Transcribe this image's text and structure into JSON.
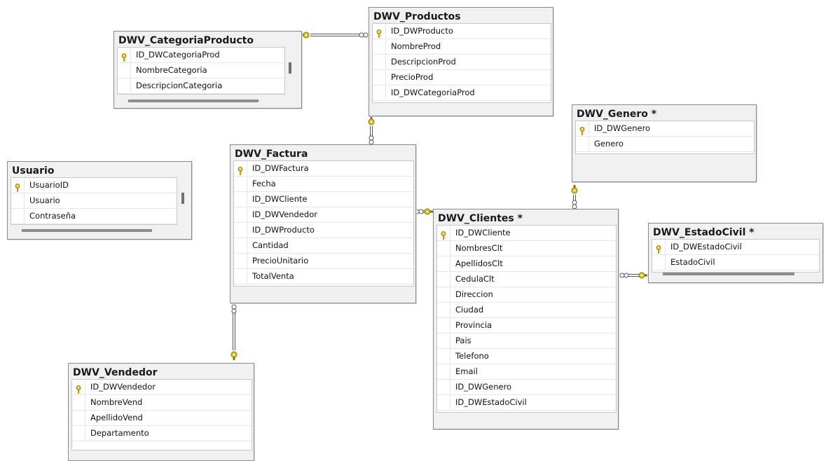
{
  "tables": {
    "categoria": {
      "title": "DWV_CategoriaProducto",
      "columns": [
        "ID_DWCategoriaProd",
        "NombreCategoria",
        "DescripcionCategoria"
      ],
      "pk": 0
    },
    "productos": {
      "title": "DWV_Productos",
      "columns": [
        "ID_DWProducto",
        "NombreProd",
        "DescripcionProd",
        "PrecioProd",
        "ID_DWCategoriaProd"
      ],
      "pk": 0
    },
    "genero": {
      "title": "DWV_Genero *",
      "columns": [
        "ID_DWGenero",
        "Genero"
      ],
      "pk": 0
    },
    "usuario": {
      "title": "Usuario",
      "columns": [
        "UsuarioID",
        "Usuario",
        "Contraseña"
      ],
      "pk": 0
    },
    "factura": {
      "title": "DWV_Factura",
      "columns": [
        "ID_DWFactura",
        "Fecha",
        "ID_DWCliente",
        "ID_DWVendedor",
        "ID_DWProducto",
        "Cantidad",
        "PrecioUnitario",
        "TotalVenta"
      ],
      "pk": 0
    },
    "clientes": {
      "title": "DWV_Clientes *",
      "columns": [
        "ID_DWCliente",
        "NombresClt",
        "ApellidosClt",
        "CedulaClt",
        "Direccion",
        "Ciudad",
        "Provincia",
        "Pais",
        "Telefono",
        "Email",
        "ID_DWGenero",
        "ID_DWEstadoCivil"
      ],
      "pk": 0
    },
    "estadocivil": {
      "title": "DWV_EstadoCivil *",
      "columns": [
        "ID_DWEstadoCivil",
        "EstadoCivil"
      ],
      "pk": 0
    },
    "vendedor": {
      "title": "DWV_Vendedor",
      "columns": [
        "ID_DWVendedor",
        "NombreVend",
        "ApellidoVend",
        "Departamento"
      ],
      "pk": 0
    }
  },
  "relationships": [
    {
      "from": "productos",
      "to": "categoria"
    },
    {
      "from": "factura",
      "to": "productos"
    },
    {
      "from": "factura",
      "to": "clientes"
    },
    {
      "from": "factura",
      "to": "vendedor"
    },
    {
      "from": "clientes",
      "to": "genero"
    },
    {
      "from": "clientes",
      "to": "estadocivil"
    }
  ],
  "colors": {
    "key": "#e8c21c",
    "line": "#555555",
    "header_bg": "#f0f0f0"
  }
}
